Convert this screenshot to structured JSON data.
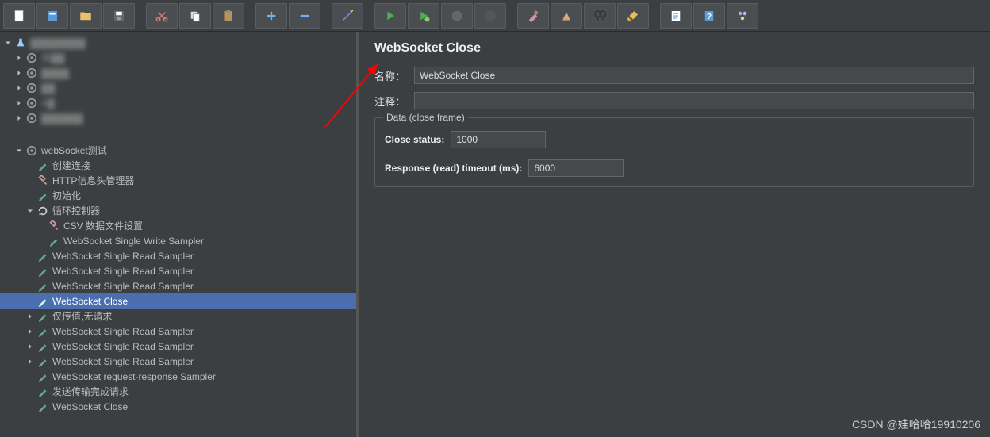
{
  "toolbar": {
    "buttons": [
      "new",
      "template",
      "open",
      "save",
      "cut",
      "copy",
      "paste",
      "add",
      "remove",
      "wand",
      "run",
      "run-remote",
      "stop",
      "stop-hard",
      "clear",
      "sweep",
      "search",
      "broom",
      "report",
      "help",
      "fn"
    ]
  },
  "tree": {
    "root_blur": "▓▓▓▓▓▓▓▓",
    "blur_items": [
      "查▓▓",
      "▓▓▓▓",
      "▓▓",
      "A▓",
      "▓▓▓▓▓▓"
    ],
    "ws_test": "webSocket测试",
    "create_conn": "创建连接",
    "http_header": "HTTP信息头管理器",
    "init": "初始化",
    "loop_ctrl": "循环控制器",
    "csv": "CSV 数据文件设置",
    "ws_write": "WebSocket Single Write Sampler",
    "ws_read1": "WebSocket Single Read Sampler",
    "ws_read2": "WebSocket Single Read Sampler",
    "ws_read3": "WebSocket Single Read Sampler",
    "ws_close": "WebSocket Close",
    "only_pass": "仅传值,无请求",
    "ws_read4": "WebSocket Single Read Sampler",
    "ws_read5": "WebSocket Single Read Sampler",
    "ws_read6": "WebSocket Single Read Sampler",
    "ws_reqresp": "WebSocket request-response Sampler",
    "send_done": "发送传输完成请求",
    "ws_close2": "WebSocket Close"
  },
  "panel": {
    "title": "WebSocket Close",
    "name_lbl": "名称：",
    "name_val": "WebSocket Close",
    "comment_lbl": "注释：",
    "comment_val": "",
    "fieldset_title": "Data (close frame)",
    "close_status_lbl": "Close status:",
    "close_status_val": "1000",
    "timeout_lbl": "Response (read) timeout (ms):",
    "timeout_val": "6000"
  },
  "watermark": "CSDN @娃哈哈19910206"
}
